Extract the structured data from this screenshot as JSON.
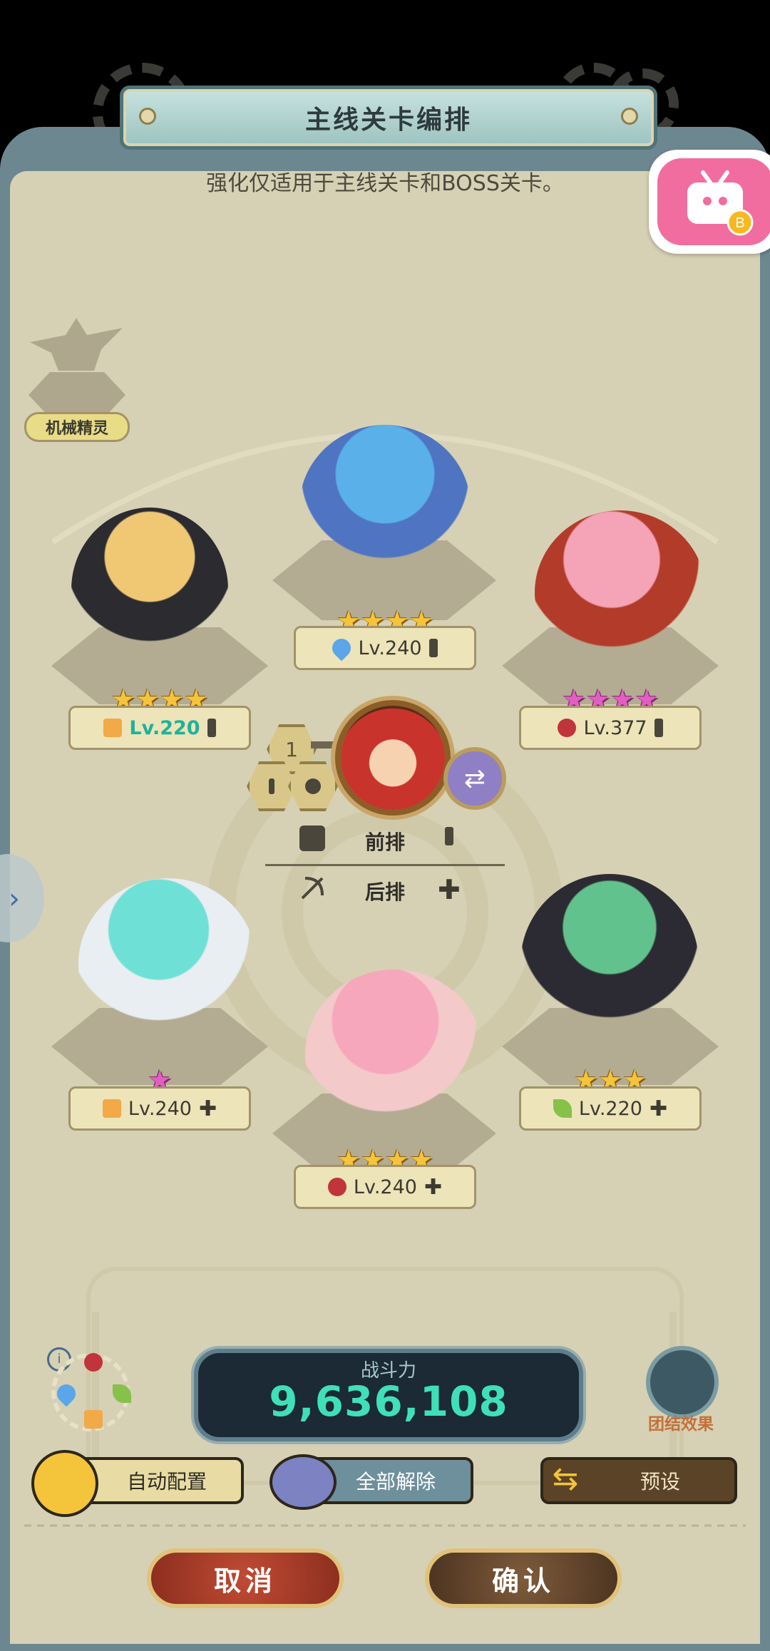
{
  "title": "主线关卡编排",
  "subtitle": "强化仅适用于主线关卡和BOSS关卡。",
  "pet": {
    "label": "机械精灵"
  },
  "heroes": [
    {
      "slot": "front-left",
      "stars": 4,
      "star_color": "gold",
      "element": "earth",
      "level": "Lv.220",
      "level_color": "#1db39a",
      "action": "sword"
    },
    {
      "slot": "front-center",
      "stars": 4,
      "star_color": "gold",
      "element": "water",
      "level": "Lv.240",
      "level_color": "#3d3a31",
      "action": "sword"
    },
    {
      "slot": "front-right",
      "stars": 4,
      "star_color": "pink",
      "element": "fire",
      "level": "Lv.377",
      "level_color": "#3d3a31",
      "action": "sword"
    },
    {
      "slot": "back-left",
      "stars": 1,
      "star_color": "pink",
      "element": "earth",
      "level": "Lv.240",
      "level_color": "#3d3a31",
      "action": "plus"
    },
    {
      "slot": "back-center",
      "stars": 4,
      "star_color": "gold",
      "element": "fire",
      "level": "Lv.240",
      "level_color": "#3d3a31",
      "action": "plus"
    },
    {
      "slot": "back-right",
      "stars": 3,
      "star_color": "gold",
      "element": "wind",
      "level": "Lv.220",
      "level_color": "#3d3a31",
      "action": "plus"
    }
  ],
  "leader": {
    "slot_number": "1"
  },
  "rows": {
    "front": "前排",
    "back": "后排"
  },
  "power": {
    "label": "战斗力",
    "value": "9,636,108"
  },
  "unite": {
    "label": "团结效果"
  },
  "buttons": {
    "auto": "自动配置",
    "clear_all": "全部解除",
    "preset": "预设",
    "cancel": "取消",
    "confirm": "确认"
  },
  "colors": {
    "water": "#5aa6e8",
    "fire": "#c0343b",
    "earth": "#f2a948",
    "wind": "#86c14a"
  }
}
